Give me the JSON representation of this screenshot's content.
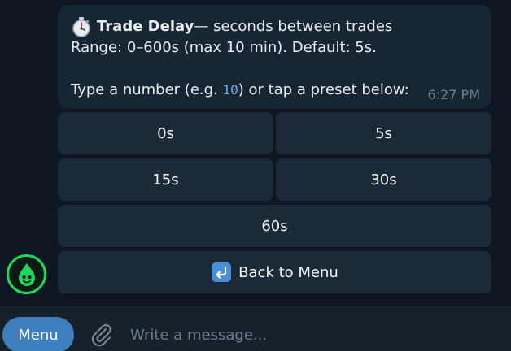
{
  "message": {
    "title_icon": "stopwatch-icon",
    "title_bold": "Trade Delay",
    "title_rest": " — seconds between trades",
    "range_line": "Range: 0–600s (max 10 min). Default: 5s.",
    "prompt_before": "Type a number (e.g. ",
    "prompt_example": "10",
    "prompt_after": ") or tap a preset below:",
    "time": "6:27 PM"
  },
  "keyboard": {
    "btn_0s": "0s",
    "btn_5s": "5s",
    "btn_15s": "15s",
    "btn_30s": "30s",
    "btn_60s": "60s",
    "back_icon": "return-arrow-icon",
    "back_label": "Back to Menu"
  },
  "composer": {
    "menu_label": "Menu",
    "attach_icon": "paperclip-icon",
    "placeholder": "Write a message..."
  },
  "colors": {
    "accent": "#3e7fc0",
    "link": "#6ab3f3",
    "avatar_ring": "#1ed760"
  }
}
